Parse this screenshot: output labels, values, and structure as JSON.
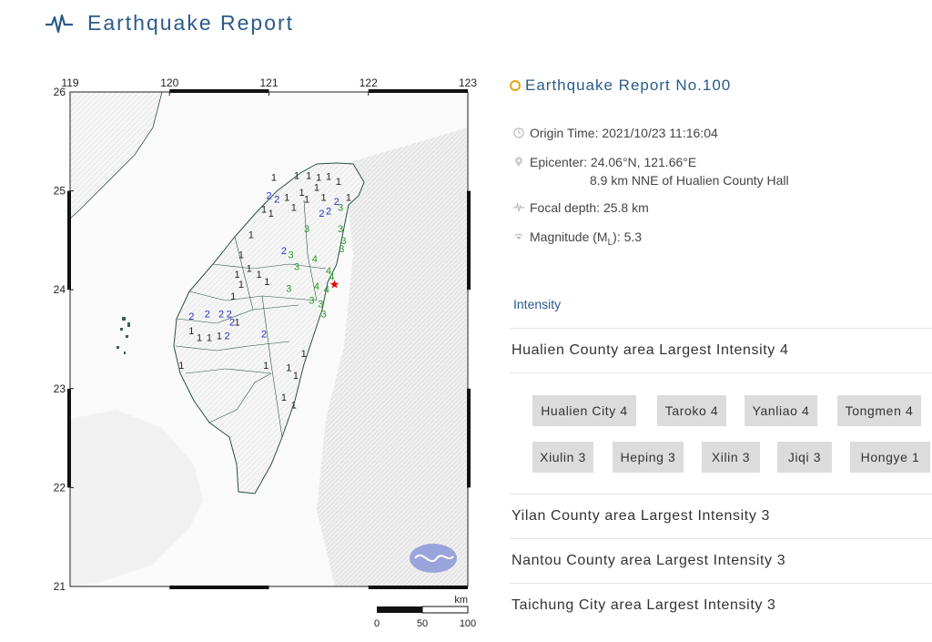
{
  "header": {
    "title": "Earthquake Report",
    "icon": "pulse-icon"
  },
  "map": {
    "lon_labels": [
      "119",
      "120",
      "121",
      "122",
      "123"
    ],
    "lat_labels": [
      "26",
      "25",
      "24",
      "23",
      "22",
      "21"
    ],
    "scale": {
      "unit": "km",
      "labels": [
        "0",
        "50",
        "100"
      ]
    },
    "epicenter_color": "#e00000",
    "intensity_colors": {
      "1": "#222222",
      "2": "#2233bb",
      "3": "#229922",
      "4": "#229922"
    },
    "stations": [
      {
        "v": "1",
        "lon": 121.05,
        "lat": 25.1
      },
      {
        "v": "1",
        "lon": 121.28,
        "lat": 25.12
      },
      {
        "v": "1",
        "lon": 121.4,
        "lat": 25.12
      },
      {
        "v": "1",
        "lon": 121.5,
        "lat": 25.1
      },
      {
        "v": "1",
        "lon": 121.6,
        "lat": 25.11
      },
      {
        "v": "1",
        "lon": 121.7,
        "lat": 25.06
      },
      {
        "v": "1",
        "lon": 121.48,
        "lat": 25.0
      },
      {
        "v": "1",
        "lon": 121.33,
        "lat": 24.95
      },
      {
        "v": "2",
        "lon": 121.0,
        "lat": 24.92
      },
      {
        "v": "2",
        "lon": 121.08,
        "lat": 24.88
      },
      {
        "v": "1",
        "lon": 121.18,
        "lat": 24.9
      },
      {
        "v": "1",
        "lon": 121.25,
        "lat": 24.8
      },
      {
        "v": "1",
        "lon": 121.38,
        "lat": 24.88
      },
      {
        "v": "1",
        "lon": 121.55,
        "lat": 24.9
      },
      {
        "v": "2",
        "lon": 121.68,
        "lat": 24.86
      },
      {
        "v": "2",
        "lon": 121.53,
        "lat": 24.74
      },
      {
        "v": "2",
        "lon": 121.6,
        "lat": 24.76
      },
      {
        "v": "3",
        "lon": 121.72,
        "lat": 24.8
      },
      {
        "v": "1",
        "lon": 121.8,
        "lat": 24.9
      },
      {
        "v": "1",
        "lon": 120.95,
        "lat": 24.78
      },
      {
        "v": "1",
        "lon": 121.02,
        "lat": 24.74
      },
      {
        "v": "1",
        "lon": 120.82,
        "lat": 24.52
      },
      {
        "v": "3",
        "lon": 121.38,
        "lat": 24.58
      },
      {
        "v": "3",
        "lon": 121.72,
        "lat": 24.58
      },
      {
        "v": "3",
        "lon": 121.75,
        "lat": 24.46
      },
      {
        "v": "3",
        "lon": 121.73,
        "lat": 24.38
      },
      {
        "v": "2",
        "lon": 121.15,
        "lat": 24.36
      },
      {
        "v": "3",
        "lon": 121.22,
        "lat": 24.32
      },
      {
        "v": "3",
        "lon": 121.28,
        "lat": 24.2
      },
      {
        "v": "4",
        "lon": 121.46,
        "lat": 24.28
      },
      {
        "v": "4",
        "lon": 121.6,
        "lat": 24.16
      },
      {
        "v": "4",
        "lon": 121.63,
        "lat": 24.1
      },
      {
        "v": "4",
        "lon": 121.48,
        "lat": 24.0
      },
      {
        "v": "4",
        "lon": 121.58,
        "lat": 23.97
      },
      {
        "v": "3",
        "lon": 121.2,
        "lat": 23.98
      },
      {
        "v": "3",
        "lon": 121.43,
        "lat": 23.86
      },
      {
        "v": "3",
        "lon": 121.52,
        "lat": 23.82
      },
      {
        "v": "3",
        "lon": 121.55,
        "lat": 23.72
      },
      {
        "v": "1",
        "lon": 120.72,
        "lat": 24.32
      },
      {
        "v": "1",
        "lon": 120.8,
        "lat": 24.18
      },
      {
        "v": "1",
        "lon": 120.9,
        "lat": 24.12
      },
      {
        "v": "1",
        "lon": 120.68,
        "lat": 24.12
      },
      {
        "v": "1",
        "lon": 120.72,
        "lat": 24.02
      },
      {
        "v": "1",
        "lon": 120.98,
        "lat": 24.05
      },
      {
        "v": "1",
        "lon": 120.64,
        "lat": 23.9
      },
      {
        "v": "2",
        "lon": 120.22,
        "lat": 23.7
      },
      {
        "v": "2",
        "lon": 120.38,
        "lat": 23.72
      },
      {
        "v": "2",
        "lon": 120.52,
        "lat": 23.72
      },
      {
        "v": "2",
        "lon": 120.6,
        "lat": 23.72
      },
      {
        "v": "2",
        "lon": 120.63,
        "lat": 23.64
      },
      {
        "v": "1",
        "lon": 120.68,
        "lat": 23.64
      },
      {
        "v": "2",
        "lon": 120.58,
        "lat": 23.5
      },
      {
        "v": "2",
        "lon": 120.95,
        "lat": 23.52
      },
      {
        "v": "1",
        "lon": 120.22,
        "lat": 23.55
      },
      {
        "v": "1",
        "lon": 120.3,
        "lat": 23.48
      },
      {
        "v": "1",
        "lon": 120.4,
        "lat": 23.48
      },
      {
        "v": "1",
        "lon": 120.5,
        "lat": 23.5
      },
      {
        "v": "1",
        "lon": 120.12,
        "lat": 23.2
      },
      {
        "v": "1",
        "lon": 120.97,
        "lat": 23.2
      },
      {
        "v": "1",
        "lon": 121.2,
        "lat": 23.18
      },
      {
        "v": "1",
        "lon": 121.27,
        "lat": 23.1
      },
      {
        "v": "1",
        "lon": 121.35,
        "lat": 23.32
      },
      {
        "v": "1",
        "lon": 121.15,
        "lat": 22.88
      },
      {
        "v": "1",
        "lon": 121.25,
        "lat": 22.8
      }
    ]
  },
  "report": {
    "title": "Earthquake Report No.100",
    "origin_time": "Origin Time: 2021/10/23 11:16:04",
    "epicenter": "Epicenter: 24.06°N, 121.66°E",
    "epicenter_desc": "8.9 km NNE of Hualien County Hall",
    "focal_depth": "Focal depth: 25.8 km",
    "magnitude_prefix": "Magnitude (M",
    "magnitude_sub": "L",
    "magnitude_suffix": "): 5.3"
  },
  "intensity": {
    "title": "Intensity",
    "counties": [
      {
        "label": "Hualien County area Largest Intensity 4"
      },
      {
        "label": "Yilan County area Largest Intensity 3"
      },
      {
        "label": "Nantou County area Largest Intensity 3"
      },
      {
        "label": "Taichung City area Largest Intensity 3"
      }
    ],
    "hualien_stations": [
      "Hualien City 4",
      "Taroko 4",
      "Yanliao 4",
      "Tongmen 4",
      "Xiulin 3",
      "Heping 3",
      "Xilin 3",
      "Jiqi 3",
      "Hongye 1"
    ]
  }
}
